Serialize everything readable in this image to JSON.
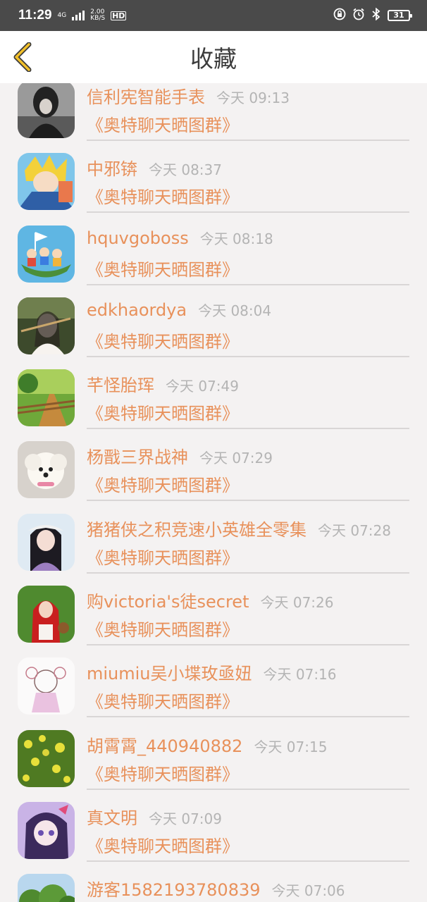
{
  "status_bar": {
    "time": "11:29",
    "network": "4G",
    "speed_value": "2.00",
    "speed_unit": "KB/S",
    "hd": "HD",
    "battery": "31"
  },
  "header": {
    "title": "收藏"
  },
  "items": [
    {
      "name": "信利宪智能手表",
      "time": "今天 09:13",
      "group": "《奥特聊天晒图群》",
      "avatar": "dark-portrait"
    },
    {
      "name": "中邪锛",
      "time": "今天 08:37",
      "group": "《奥特聊天晒图群》",
      "avatar": "anime-blue"
    },
    {
      "name": "hquvgoboss",
      "time": "今天 08:18",
      "group": "《奥特聊天晒图群》",
      "avatar": "cartoon-boat"
    },
    {
      "name": "edkhaordya",
      "time": "今天 08:04",
      "group": "《奥特聊天晒图群》",
      "avatar": "girl-flute"
    },
    {
      "name": "芊怪胎珲",
      "time": "今天 07:49",
      "group": "《奥特聊天晒图群》",
      "avatar": "forest-path"
    },
    {
      "name": "杨戬三界战神",
      "time": "今天 07:29",
      "group": "《奥特聊天晒图群》",
      "avatar": "white-puppy"
    },
    {
      "name": "猪猪侠之积竞速小英雄全零集",
      "time": "今天 07:28",
      "group": "《奥特聊天晒图群》",
      "avatar": "girl-hat"
    },
    {
      "name": "购victoria's徒secret",
      "time": "今天 07:26",
      "group": "《奥特聊天晒图群》",
      "avatar": "red-hood"
    },
    {
      "name": "miumiu吴小堞玫亟妞",
      "time": "今天 07:16",
      "group": "《奥特聊天晒图群》",
      "avatar": "anime-sketch"
    },
    {
      "name": "胡霄霄_440940882",
      "time": "今天 07:15",
      "group": "《奥特聊天晒图群》",
      "avatar": "yellow-flowers"
    },
    {
      "name": "真文明",
      "time": "今天 07:09",
      "group": "《奥特聊天晒图群》",
      "avatar": "anime-purple"
    },
    {
      "name": "游客1582193780839",
      "time": "今天 07:06",
      "group": "",
      "avatar": "trees"
    }
  ],
  "colors": {
    "accent": "#e8915b",
    "time_gray": "#b4b4b4",
    "status_bg": "#4a4a4a",
    "back_arrow": "#f2c02a"
  }
}
